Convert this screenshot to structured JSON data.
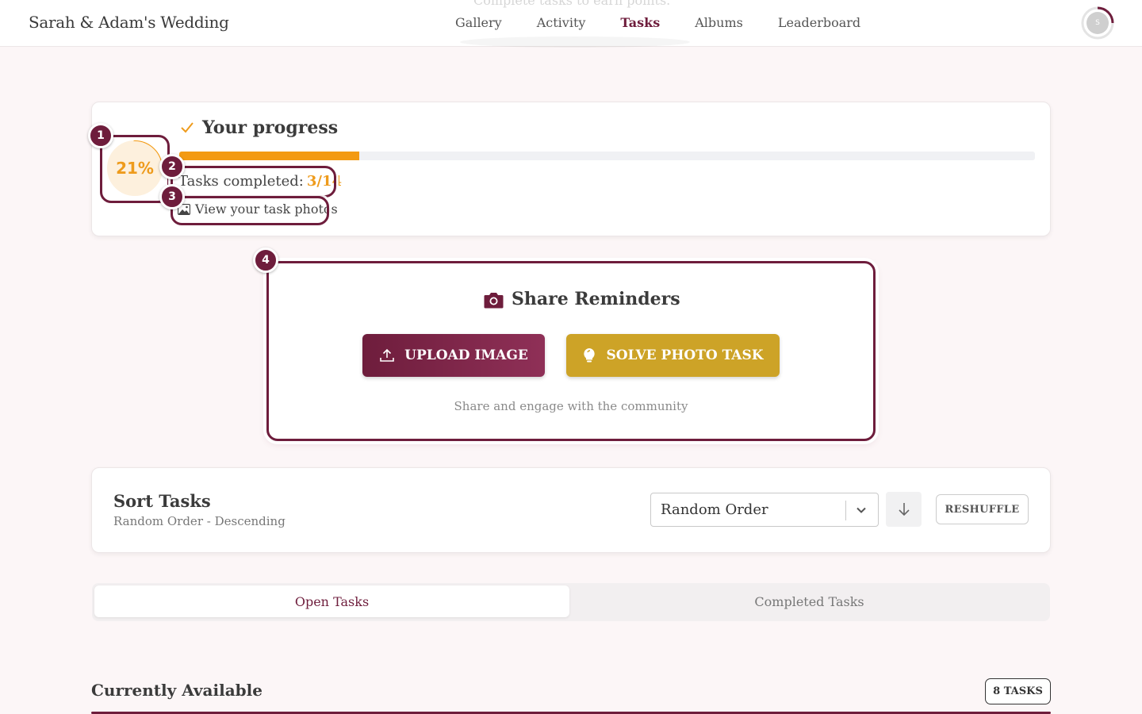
{
  "header": {
    "brand": "Sarah & Adam's Wedding",
    "nav": [
      "Gallery",
      "Activity",
      "Tasks",
      "Albums",
      "Leaderboard"
    ],
    "active_nav": "Tasks",
    "faded_subtitle": "Complete tasks to earn points.",
    "avatar_initial": "S"
  },
  "progress": {
    "title": "Your progress",
    "percent_label": "21%",
    "percent": 21,
    "tasks_label": "Tasks completed:",
    "tasks_count": "3/14",
    "photos_link": "View your task photos"
  },
  "tour_badges": [
    "1",
    "2",
    "3",
    "4"
  ],
  "share": {
    "title": "Share Reminders",
    "upload_label": "UPLOAD IMAGE",
    "solve_label": "SOLVE PHOTO TASK",
    "subtitle": "Share and engage with the community"
  },
  "sort": {
    "title": "Sort Tasks",
    "subtitle": "Random Order - Descending",
    "selected": "Random Order",
    "reshuffle_label": "RESHUFFLE"
  },
  "tabs": {
    "open": "Open Tasks",
    "completed": "Completed Tasks"
  },
  "available": {
    "title": "Currently Available",
    "count_badge": "8 TASKS"
  },
  "colors": {
    "brand": "#6e1d3c",
    "accent_orange": "#f39a12",
    "gold": "#cda327",
    "background": "#fcf6f7"
  }
}
